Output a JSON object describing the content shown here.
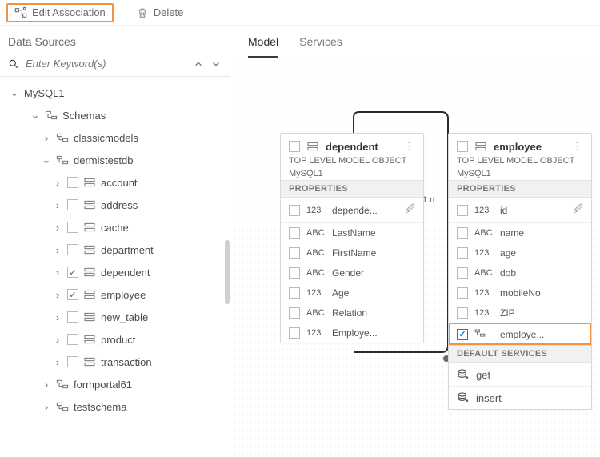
{
  "toolbar": {
    "editAssociation": "Edit Association",
    "delete": "Delete"
  },
  "left": {
    "title": "Data Sources",
    "searchPlaceholder": "Enter Keyword(s)",
    "root": "MySQL1",
    "schemas": "Schemas",
    "dbs": {
      "classicmodels": "classicmodels",
      "dermistestdb": "dermistestdb",
      "formportal61": "formportal61",
      "testschema": "testschema"
    },
    "tables": {
      "account": "account",
      "address": "address",
      "cache": "cache",
      "department": "department",
      "dependent": "dependent",
      "employee": "employee",
      "new_table": "new_table",
      "product": "product",
      "transaction": "transaction"
    }
  },
  "tabs": {
    "model": "Model",
    "services": "Services"
  },
  "rel": {
    "label": "1:n"
  },
  "cards": {
    "dependent": {
      "title": "dependent",
      "sub1": "TOP LEVEL MODEL OBJECT",
      "sub2": "MySQL1",
      "propHeader": "PROPERTIES",
      "props": [
        {
          "type": "123",
          "name": "depende...",
          "key": true
        },
        {
          "type": "ABC",
          "name": "LastName"
        },
        {
          "type": "ABC",
          "name": "FirstName"
        },
        {
          "type": "ABC",
          "name": "Gender"
        },
        {
          "type": "123",
          "name": "Age"
        },
        {
          "type": "ABC",
          "name": "Relation"
        },
        {
          "type": "123",
          "name": "Employe..."
        }
      ]
    },
    "employee": {
      "title": "employee",
      "sub1": "TOP LEVEL MODEL OBJECT",
      "sub2": "MySQL1",
      "propHeader": "PROPERTIES",
      "svcHeader": "DEFAULT SERVICES",
      "props": [
        {
          "type": "123",
          "name": "id",
          "key": true
        },
        {
          "type": "ABC",
          "name": "name"
        },
        {
          "type": "123",
          "name": "age"
        },
        {
          "type": "ABC",
          "name": "dob"
        },
        {
          "type": "123",
          "name": "mobileNo"
        },
        {
          "type": "123",
          "name": "ZIP"
        },
        {
          "type": "ref",
          "name": "employe...",
          "checked": true,
          "highlight": true
        }
      ],
      "services": [
        {
          "name": "get"
        },
        {
          "name": "insert"
        }
      ]
    }
  }
}
